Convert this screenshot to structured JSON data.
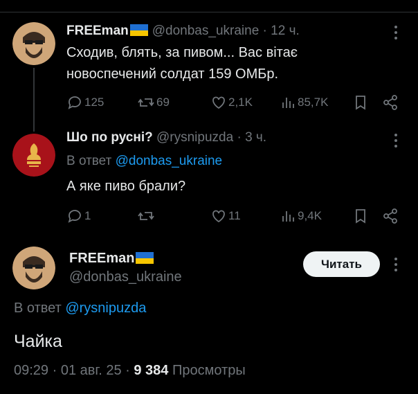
{
  "tweet1": {
    "name": "FREEman",
    "handle": "@donbas_ukraine",
    "dot": "·",
    "time": "12 ч.",
    "text_line1": "Сходив, блять, за пивом... Вас вітає",
    "text_line2": "новоспечений солдат 159 ОМБр.",
    "replies": "125",
    "retweets": "69",
    "likes": "2,1K",
    "views": "85,7K"
  },
  "tweet2": {
    "name": "Шо по русні?",
    "handle": "@rysnipuzda",
    "dot": "·",
    "time": "3 ч.",
    "reply_prefix": "В ответ ",
    "reply_to": "@donbas_ukraine",
    "text": "А яке пиво брали?",
    "replies": "1",
    "retweets": "",
    "likes": "11",
    "views": "9,4K"
  },
  "main": {
    "name": "FREEman",
    "handle": "@donbas_ukraine",
    "follow_label": "Читать",
    "reply_prefix": "В ответ ",
    "reply_to": "@rysnipuzda",
    "text": "Чайка",
    "time": "09:29 · 01 авг. 25 · ",
    "views_count": "9 384",
    "views_label": " Просмотры"
  },
  "colors": {
    "background": "#000000",
    "text": "#e7e9ea",
    "muted": "#71767b",
    "link": "#1d9bf0",
    "flag_blue": "#1f6fd1",
    "flag_yellow": "#f7c600"
  },
  "icons": [
    "reply-icon",
    "retweet-icon",
    "like-icon",
    "views-icon",
    "bookmark-icon",
    "share-icon",
    "more-icon"
  ]
}
